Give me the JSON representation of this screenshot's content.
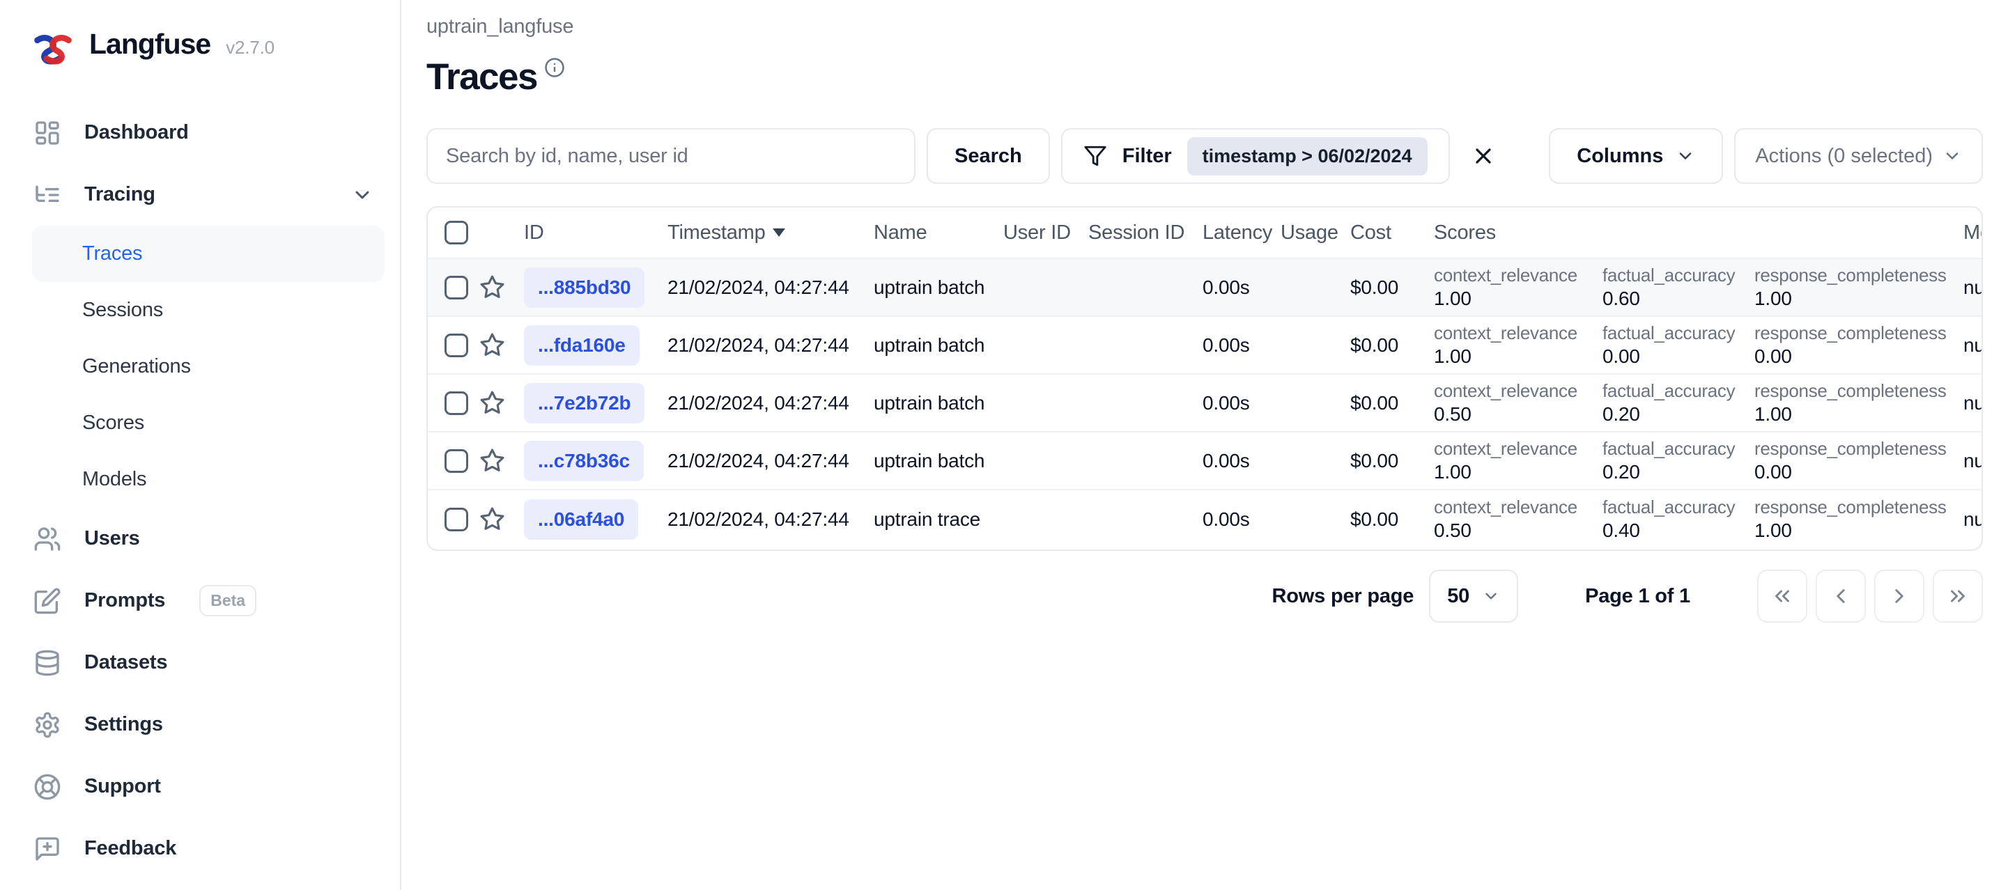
{
  "app": {
    "name": "Langfuse",
    "version": "v2.7.0"
  },
  "sidebar": {
    "dashboard": "Dashboard",
    "tracing": "Tracing",
    "tracing_children": [
      "Traces",
      "Sessions",
      "Generations",
      "Scores",
      "Models"
    ],
    "active_item": "Traces",
    "users": "Users",
    "prompts": "Prompts",
    "prompts_badge": "Beta",
    "datasets": "Datasets",
    "settings": "Settings",
    "support": "Support",
    "feedback": "Feedback"
  },
  "header": {
    "breadcrumb": "uptrain_langfuse",
    "title": "Traces"
  },
  "toolbar": {
    "search_placeholder": "Search by id, name, user id",
    "search_button": "Search",
    "filter_button": "Filter",
    "filter_chip": "timestamp > 06/02/2024",
    "columns_button": "Columns",
    "actions_button": "Actions (0 selected)"
  },
  "table": {
    "header": {
      "id": "ID",
      "timestamp": "Timestamp",
      "name": "Name",
      "user_id": "User ID",
      "session_id": "Session ID",
      "latency": "Latency",
      "usage": "Usage",
      "cost": "Cost",
      "scores": "Scores",
      "metadata": "Metadata"
    },
    "sort": {
      "column": "Timestamp",
      "direction": "desc"
    },
    "rows": [
      {
        "id": "...885bd30",
        "timestamp": "21/02/2024, 04:27:44",
        "name": "uptrain batch",
        "latency": "0.00s",
        "cost": "$0.00",
        "metadata": "null",
        "highlighted": true,
        "scores": [
          {
            "label": "context_relevance",
            "value": "1.00"
          },
          {
            "label": "factual_accuracy",
            "value": "0.60"
          },
          {
            "label": "response_completeness",
            "value": "1.00"
          }
        ]
      },
      {
        "id": "...fda160e",
        "timestamp": "21/02/2024, 04:27:44",
        "name": "uptrain batch",
        "latency": "0.00s",
        "cost": "$0.00",
        "metadata": "null",
        "highlighted": false,
        "scores": [
          {
            "label": "context_relevance",
            "value": "1.00"
          },
          {
            "label": "factual_accuracy",
            "value": "0.00"
          },
          {
            "label": "response_completeness",
            "value": "0.00"
          }
        ]
      },
      {
        "id": "...7e2b72b",
        "timestamp": "21/02/2024, 04:27:44",
        "name": "uptrain batch",
        "latency": "0.00s",
        "cost": "$0.00",
        "metadata": "null",
        "highlighted": false,
        "scores": [
          {
            "label": "context_relevance",
            "value": "0.50"
          },
          {
            "label": "factual_accuracy",
            "value": "0.20"
          },
          {
            "label": "response_completeness",
            "value": "1.00"
          }
        ]
      },
      {
        "id": "...c78b36c",
        "timestamp": "21/02/2024, 04:27:44",
        "name": "uptrain batch",
        "latency": "0.00s",
        "cost": "$0.00",
        "metadata": "null",
        "highlighted": false,
        "scores": [
          {
            "label": "context_relevance",
            "value": "1.00"
          },
          {
            "label": "factual_accuracy",
            "value": "0.20"
          },
          {
            "label": "response_completeness",
            "value": "0.00"
          }
        ]
      },
      {
        "id": "...06af4a0",
        "timestamp": "21/02/2024, 04:27:44",
        "name": "uptrain trace",
        "latency": "0.00s",
        "cost": "$0.00",
        "metadata": "null",
        "highlighted": false,
        "scores": [
          {
            "label": "context_relevance",
            "value": "0.50"
          },
          {
            "label": "factual_accuracy",
            "value": "0.40"
          },
          {
            "label": "response_completeness",
            "value": "1.00"
          }
        ]
      }
    ]
  },
  "pagination": {
    "rows_per_page_label": "Rows per page",
    "rows_per_page_value": "50",
    "page_label": "Page 1 of 1"
  },
  "colors": {
    "accent_blue": "#2563eb",
    "id_text": "#2b50e0",
    "id_bg": "#eaedfb",
    "chip_bg": "#e3e7ef",
    "row_highlight": "#f7f8fa",
    "border": "#e7e9ee",
    "logo_red": "#dc2626",
    "logo_blue": "#1e40af"
  }
}
